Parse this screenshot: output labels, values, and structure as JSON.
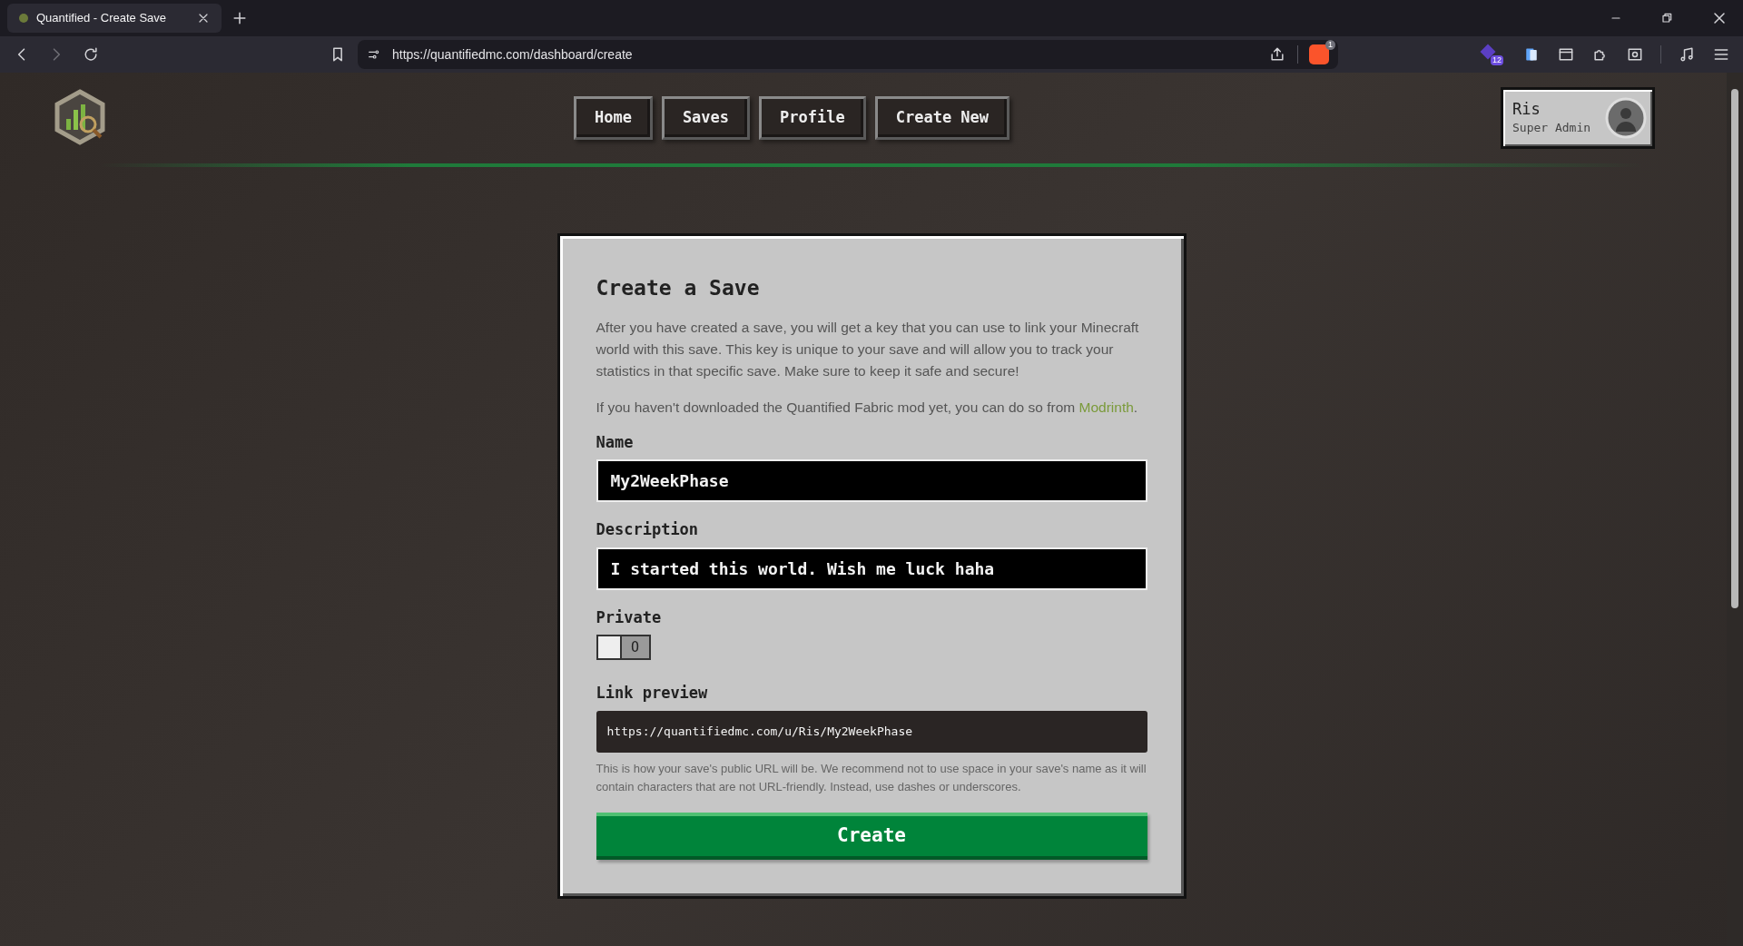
{
  "browser": {
    "tab": {
      "title": "Quantified - Create Save",
      "selected": true
    },
    "url": "https://quantifiedmc.com/dashboard/create",
    "shield_badge": "1",
    "extension_badge": "12"
  },
  "nav": [
    {
      "label": "Home"
    },
    {
      "label": "Saves"
    },
    {
      "label": "Profile"
    },
    {
      "label": "Create New"
    }
  ],
  "user": {
    "name": "Ris",
    "role": "Super Admin"
  },
  "form": {
    "title": "Create a Save",
    "intro": "After you have created a save, you will get a key that you can use to link your Minecraft world with this save. This key is unique to your save and will allow you to track your statistics in that specific save. Make sure to keep it safe and secure!",
    "mod_note": "If you haven't downloaded the Quantified Fabric mod yet, you can do so from ",
    "mod_link": "Modrinth",
    "mod_end": ".",
    "name": {
      "label": "Name",
      "value": "My2WeekPhase"
    },
    "description": {
      "label": "Description",
      "value": "I started this world. Wish me luck haha"
    },
    "private": {
      "label": "Private",
      "on": false,
      "glyph": "O"
    },
    "link_preview": {
      "label": "Link preview",
      "value": "https://quantifiedmc.com/u/Ris/My2WeekPhase"
    },
    "hint": "This is how your save's public URL will be. We recommend not to use space in your save's name as it will contain characters that are not URL-friendly. Instead, use dashes or underscores.",
    "submit": "Create"
  }
}
